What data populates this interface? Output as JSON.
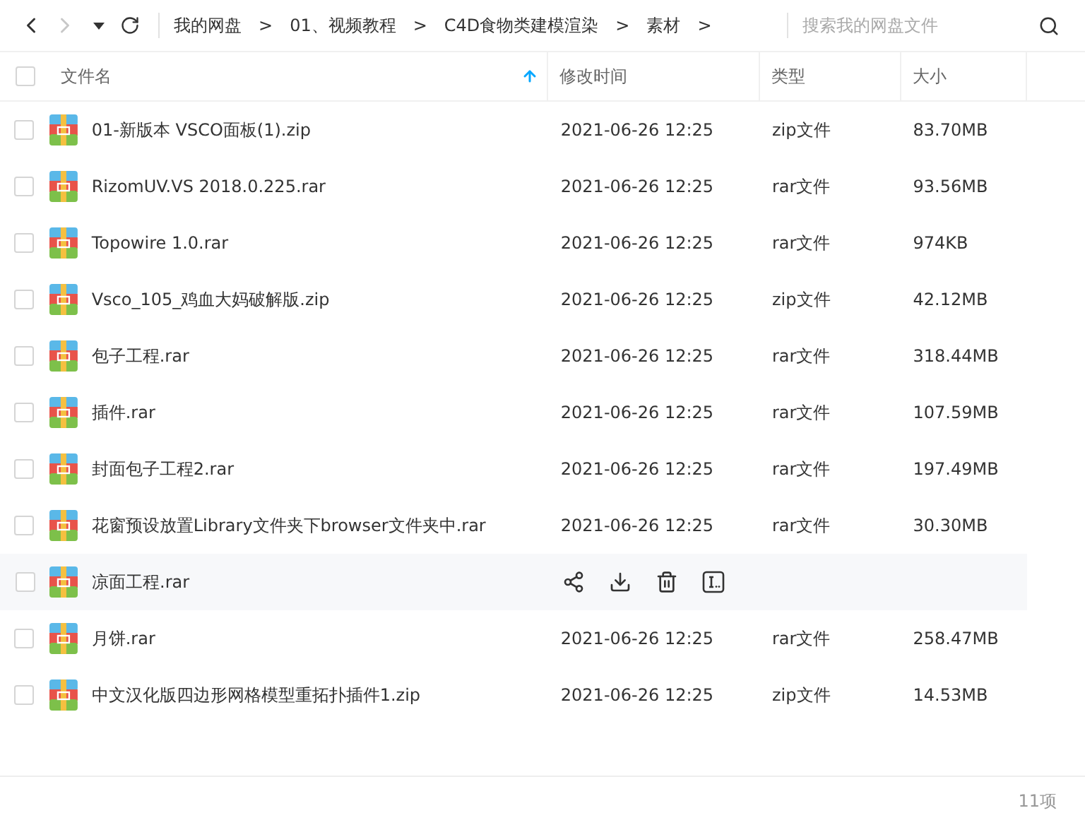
{
  "toolbar": {
    "forward_disabled": true,
    "breadcrumbs": [
      "我的网盘",
      "01、视频教程",
      "C4D食物类建模渲染",
      "素材"
    ],
    "separator": ">",
    "search": {
      "placeholder": "搜索我的网盘文件"
    }
  },
  "table": {
    "select_all_checked": false,
    "columns": [
      {
        "label": "文件名",
        "sorted": true
      },
      {
        "label": "修改时间",
        "sorted": false
      },
      {
        "label": "类型",
        "sorted": false
      },
      {
        "label": "大小",
        "sorted": false
      }
    ],
    "rows": [
      {
        "name": "01-新版本 VSCO面板(1).zip",
        "date": "2021-06-26 12:25",
        "type": "zip文件",
        "size": "83.70MB",
        "checked": false,
        "hovered": false
      },
      {
        "name": "RizomUV.VS 2018.0.225.rar",
        "date": "2021-06-26 12:25",
        "type": "rar文件",
        "size": "93.56MB",
        "checked": false,
        "hovered": false
      },
      {
        "name": "Topowire 1.0.rar",
        "date": "2021-06-26 12:25",
        "type": "rar文件",
        "size": "974KB",
        "checked": false,
        "hovered": false
      },
      {
        "name": "Vsco_105_鸡血大妈破解版.zip",
        "date": "2021-06-26 12:25",
        "type": "zip文件",
        "size": "42.12MB",
        "checked": false,
        "hovered": false
      },
      {
        "name": "包子工程.rar",
        "date": "2021-06-26 12:25",
        "type": "rar文件",
        "size": "318.44MB",
        "checked": false,
        "hovered": false
      },
      {
        "name": "插件.rar",
        "date": "2021-06-26 12:25",
        "type": "rar文件",
        "size": "107.59MB",
        "checked": false,
        "hovered": false
      },
      {
        "name": "封面包子工程2.rar",
        "date": "2021-06-26 12:25",
        "type": "rar文件",
        "size": "197.49MB",
        "checked": false,
        "hovered": false
      },
      {
        "name": "花窗预设放置Library文件夹下browser文件夹中.rar",
        "date": "2021-06-26 12:25",
        "type": "rar文件",
        "size": "30.30MB",
        "checked": false,
        "hovered": false
      },
      {
        "name": "凉面工程.rar",
        "checked": false,
        "hovered": true
      },
      {
        "name": "月饼.rar",
        "date": "2021-06-26 12:25",
        "type": "rar文件",
        "size": "258.47MB",
        "checked": false,
        "hovered": false
      },
      {
        "name": "中文汉化版四边形网格模型重拓扑插件1.zip",
        "date": "2021-06-26 12:25",
        "type": "zip文件",
        "size": "14.53MB",
        "checked": false,
        "hovered": false
      }
    ]
  },
  "status_bar": {
    "count": "11项"
  }
}
